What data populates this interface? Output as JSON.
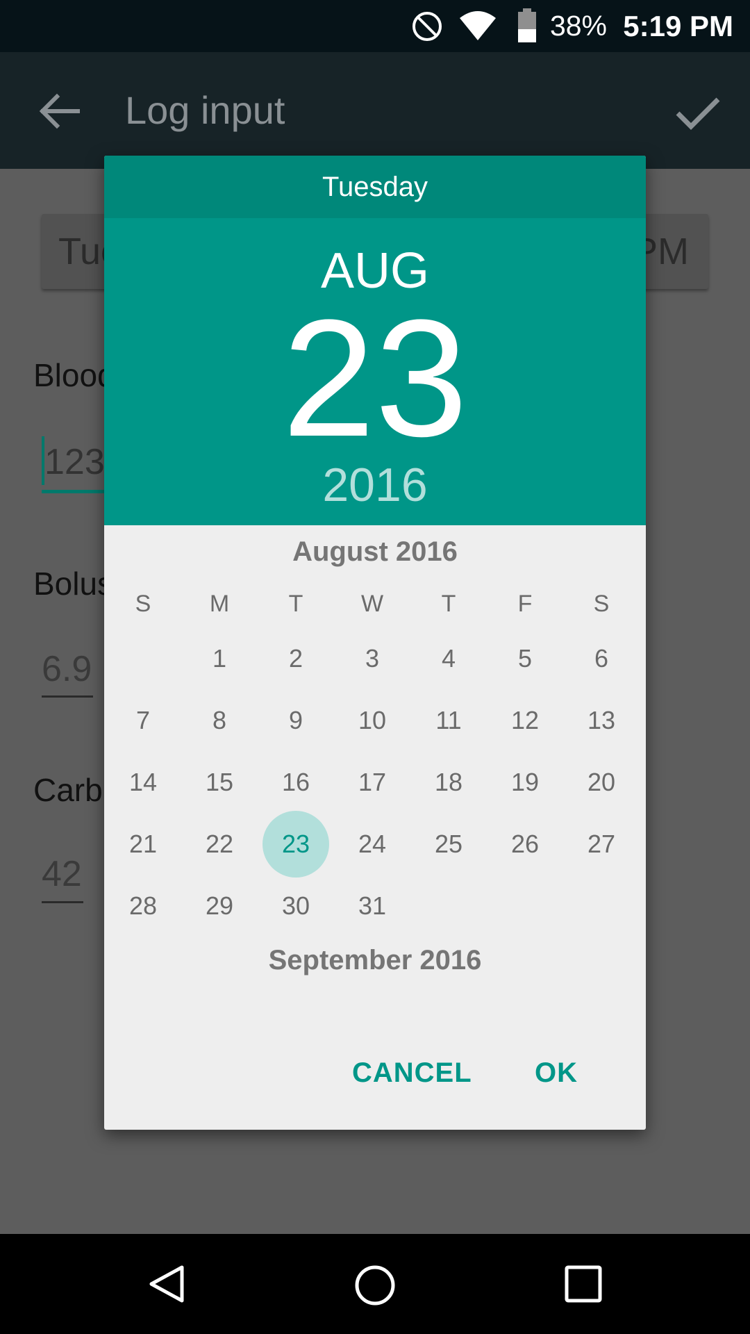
{
  "status_bar": {
    "battery_percent": "38%",
    "time": "5:19 PM"
  },
  "app_bar": {
    "title": "Log input"
  },
  "form": {
    "date_text": "Tue",
    "time_suffix": "PM",
    "blood_label": "Blood",
    "blood_value": "123",
    "bolus_label": "Bolus",
    "bolus_value": "6.9",
    "carbs_label": "Carb",
    "carbs_value": "42"
  },
  "dialog": {
    "weekday": "Tuesday",
    "month": "AUG",
    "day": "23",
    "year": "2016",
    "calendar_title": "August 2016",
    "next_month_title": "September 2016",
    "weekdays": [
      "S",
      "M",
      "T",
      "W",
      "T",
      "F",
      "S"
    ],
    "days": [
      "1",
      "2",
      "3",
      "4",
      "5",
      "6",
      "7",
      "8",
      "9",
      "10",
      "11",
      "12",
      "13",
      "14",
      "15",
      "16",
      "17",
      "18",
      "19",
      "20",
      "21",
      "22",
      "23",
      "24",
      "25",
      "26",
      "27",
      "28",
      "29",
      "30",
      "31"
    ],
    "first_weekday_index": 1,
    "selected_day": "23",
    "cancel_label": "CANCEL",
    "ok_label": "OK"
  },
  "colors": {
    "accent": "#009688",
    "accent_dark": "#00887a",
    "selected_bg": "#b2dfdb"
  }
}
